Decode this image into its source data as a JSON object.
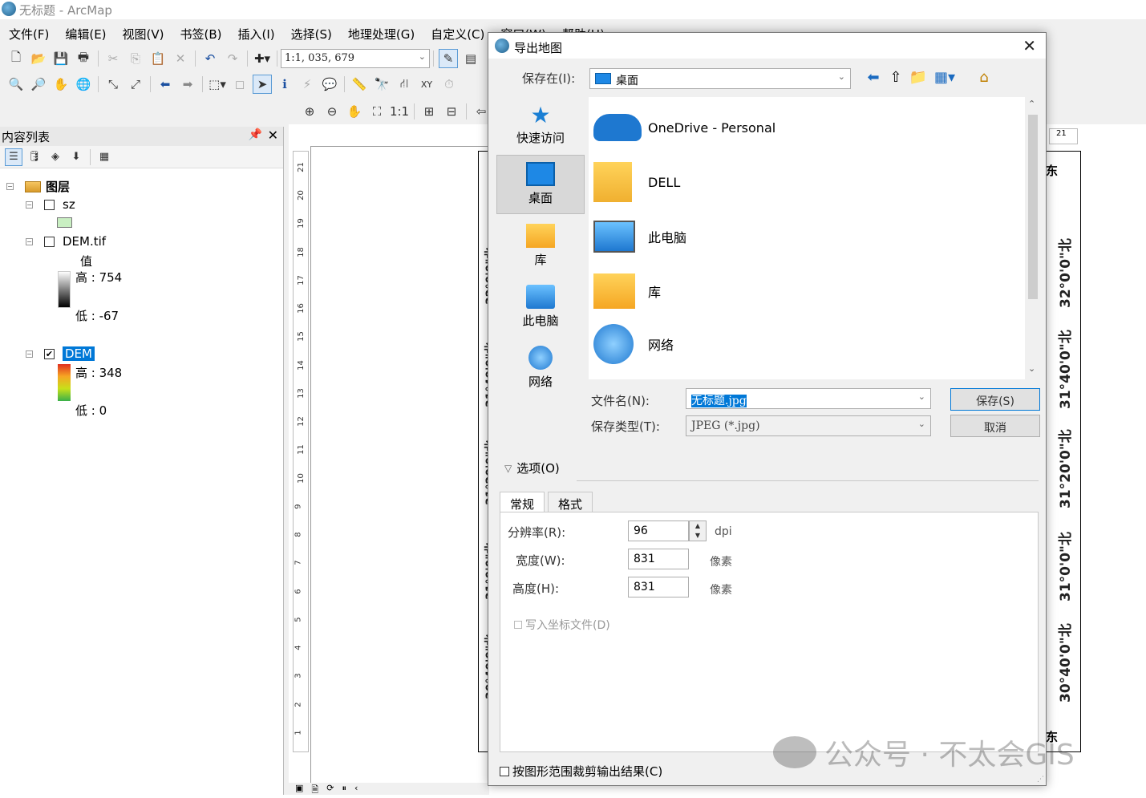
{
  "window": {
    "title": "无标题 - ArcMap"
  },
  "menu": [
    "文件(F)",
    "编辑(E)",
    "视图(V)",
    "书签(B)",
    "插入(I)",
    "选择(S)",
    "地理处理(G)",
    "自定义(C)",
    "窗口(W)",
    "帮助(H)"
  ],
  "toolbar": {
    "scale": "1:1, 035, 679"
  },
  "toc": {
    "title": "内容列表",
    "root": "图层",
    "layers": [
      {
        "name": "sz",
        "checked": false
      },
      {
        "name": "DEM.tif",
        "checked": false,
        "legend_title": "值",
        "high": "高 : 754",
        "low": "低 : -67"
      },
      {
        "name": "DEM",
        "checked": true,
        "high": "高 : 348",
        "low": "低 : 0"
      }
    ],
    "sz_swatch_color": "#c9efc2"
  },
  "layout": {
    "ruler_v": [
      "21",
      "20",
      "19",
      "18",
      "17",
      "16",
      "15",
      "14",
      "13",
      "12",
      "11",
      "10",
      "9",
      "8",
      "7",
      "6",
      "5",
      "4",
      "3",
      "2",
      "1"
    ],
    "ruler_h_right": "21",
    "lat_right": [
      "32°0'0\"北",
      "31°40'0\"北",
      "31°20'0\"北",
      "31°0'0\"北",
      "30°40'0\"北"
    ],
    "lat_left": [
      "32°0'0\"北",
      "31°40'0\"北",
      "31°20'0\"北",
      "31°0'0\"北",
      "30°40'0\"北"
    ],
    "dir_top": "东",
    "dir_bottom": "东"
  },
  "dialog": {
    "title": "导出地图",
    "save_in_label": "保存在(I):",
    "save_in_value": "桌面",
    "places": [
      "快速访问",
      "桌面",
      "库",
      "此电脑",
      "网络"
    ],
    "files": [
      "OneDrive - Personal",
      "DELL",
      "此电脑",
      "库",
      "网络"
    ],
    "filename_label": "文件名(N):",
    "filename_value": "无标题.jpg",
    "filetype_label": "保存类型(T):",
    "filetype_value": "JPEG (*.jpg)",
    "save_button": "保存(S)",
    "cancel_button": "取消",
    "options_label": "选项(O)",
    "tabs": [
      "常规",
      "格式"
    ],
    "resolution_label": "分辨率(R):",
    "resolution_value": "96",
    "resolution_unit": "dpi",
    "width_label": "宽度(W):",
    "width_value": "831",
    "width_unit": "像素",
    "height_label": "高度(H):",
    "height_value": "831",
    "height_unit": "像素",
    "world_file_label": "写入坐标文件(D)",
    "clip_label": "按图形范围裁剪输出结果(C)"
  },
  "watermark": "公众号 · 不太会GIS"
}
